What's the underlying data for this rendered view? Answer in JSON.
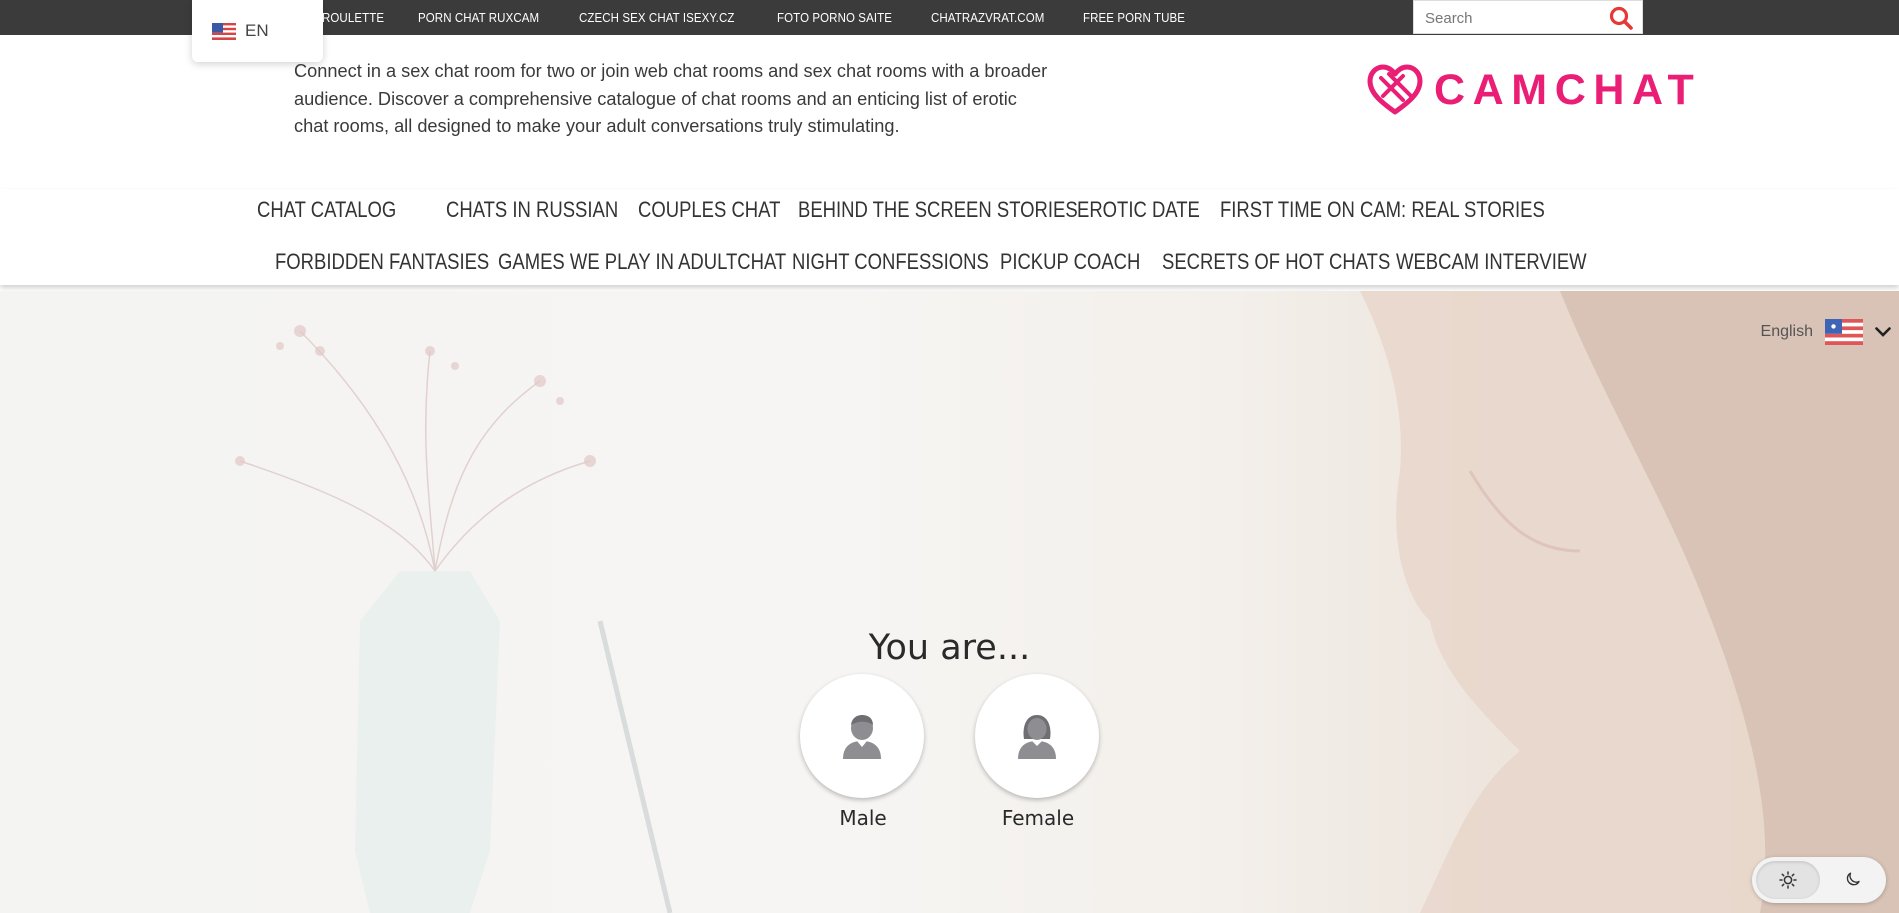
{
  "topbar": {
    "links": [
      "Roulette",
      "Porn Chat RuxCam",
      "Czech Sex Chat iSexy.cz",
      "Foto Porno Saite",
      "ChatRazvrat.com",
      "Free Porn Tube"
    ],
    "search_placeholder": "Search"
  },
  "language_popup": {
    "code": "EN"
  },
  "header": {
    "intro": "Connect in a sex chat room for two or join web chat rooms and sex chat rooms with a broader audience. Discover a comprehensive catalogue of chat rooms and an enticing list of erotic chat rooms, all designed to make your adult conversations truly stimulating.",
    "logo_text": "CAMCHAT",
    "brand_color": "#e91e74"
  },
  "nav": {
    "row1": [
      "Chat Catalog",
      "Chats in Russian",
      "Couples Chat",
      "Behind the Screen Stories",
      "Erotic Date",
      "First Time on Cam: Real Stories"
    ],
    "row2": [
      "Forbidden Fantasies",
      "Games We Play in AdultChat",
      "Night Confessions",
      "Pickup Coach",
      "Secrets of Hot Chats",
      "Webcam Interview"
    ]
  },
  "hero": {
    "language_label": "English",
    "prompt": "You are...",
    "male_label": "Male",
    "female_label": "Female"
  },
  "icons": {
    "search": "search-icon",
    "flag": "us-flag-icon",
    "chevron": "chevron-down-icon",
    "male": "male-avatar-icon",
    "female": "female-avatar-icon",
    "sun": "sun-icon",
    "moon": "moon-icon"
  }
}
